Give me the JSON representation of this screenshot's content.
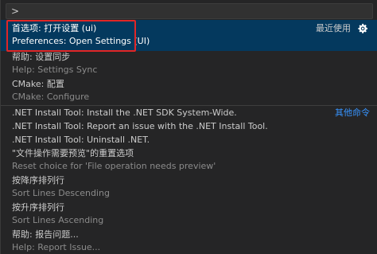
{
  "input": {
    "value": ">"
  },
  "items": [
    {
      "title": "首选项: 打开设置 (ui)",
      "subtitle": "Preferences: Open Settings (UI)",
      "right": "最近使用"
    },
    {
      "title": "帮助: 设置同步",
      "subtitle": "Help: Settings Sync"
    },
    {
      "title": "CMake: 配置",
      "subtitle": "CMake: Configure"
    },
    {
      "title": ".NET Install Tool: Install the .NET SDK System-Wide.",
      "right": "其他命令"
    },
    {
      "title": ".NET Install Tool: Report an issue with the .NET Install Tool."
    },
    {
      "title": ".NET Install Tool: Uninstall .NET."
    },
    {
      "title": "\"文件操作需要预览\"的重置选项",
      "subtitle": "Reset choice for 'File operation needs preview'"
    },
    {
      "title": "按降序排列行",
      "subtitle": "Sort Lines Descending"
    },
    {
      "title": "按升序排列行",
      "subtitle": "Sort Lines Ascending"
    },
    {
      "title": "帮助: 报告问题...",
      "subtitle": "Help: Report Issue..."
    }
  ],
  "colors": {
    "selected_bg": "#04395e",
    "highlight_border": "#e12626",
    "link": "#3794ff"
  },
  "icons": {
    "settings": "gear-icon"
  }
}
